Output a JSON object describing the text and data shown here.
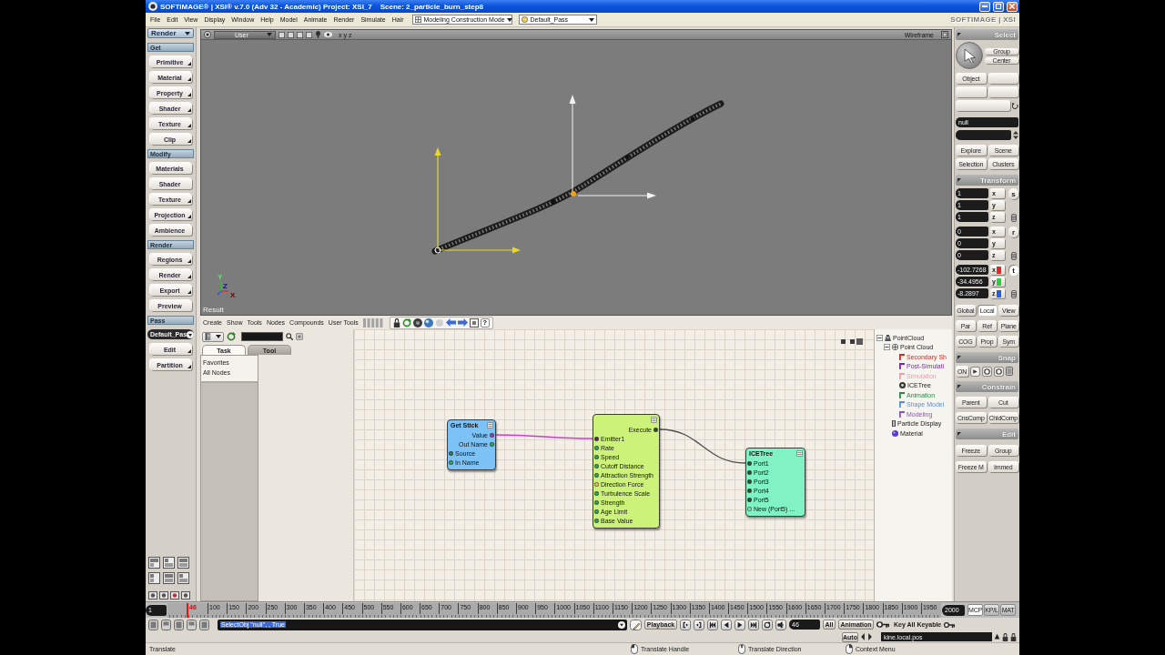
{
  "window": {
    "title": "SOFTIMAGE® | XSI® v.7.0 (Adv 32 - Academic) Project: XSI_7    Scene: 2_particle_burn_step8"
  },
  "menu_bar": {
    "items": [
      "File",
      "Edit",
      "View",
      "Display",
      "Window",
      "Help",
      "Model",
      "Animate",
      "Render",
      "Simulate",
      "Hair"
    ],
    "mode": "Modeling Construction Mode",
    "pass": "Default_Pass",
    "logo": "SOFTIMAGE | XSI"
  },
  "left_toolbar": {
    "module": "Render",
    "sections": [
      {
        "title": "Get",
        "buttons": [
          {
            "label": "Primitive",
            "submenu": true
          },
          {
            "label": "Material",
            "submenu": true
          },
          {
            "label": "Property",
            "submenu": true
          },
          {
            "label": "Shader",
            "submenu": true
          },
          {
            "label": "Texture",
            "submenu": true
          },
          {
            "label": "Clip",
            "submenu": true
          }
        ]
      },
      {
        "title": "Modify",
        "buttons": [
          {
            "label": "Materials",
            "submenu": false
          },
          {
            "label": "Shader",
            "submenu": false
          },
          {
            "label": "Texture",
            "submenu": true
          },
          {
            "label": "Projection",
            "submenu": true
          },
          {
            "label": "Ambience",
            "submenu": false
          }
        ]
      },
      {
        "title": "Render",
        "buttons": [
          {
            "label": "Regions",
            "submenu": true
          },
          {
            "label": "Render",
            "submenu": true
          },
          {
            "label": "Export",
            "submenu": true
          },
          {
            "label": "Preview",
            "submenu": false
          }
        ]
      },
      {
        "title": "Pass",
        "dropdown": "Default_Pas",
        "buttons": [
          {
            "label": "Edit",
            "submenu": true
          },
          {
            "label": "Partition",
            "submenu": true
          }
        ]
      }
    ]
  },
  "viewport": {
    "camera": "User",
    "axes": "x y z",
    "mode": "Wireframe",
    "axis_labels": [
      "Y",
      "Z",
      "X"
    ],
    "panel_label": "Result"
  },
  "ice_tree": {
    "menu": [
      "Create",
      "Show",
      "Tools",
      "Nodes",
      "Compounds",
      "User Tools"
    ],
    "help": "?",
    "tabs": [
      {
        "label": "Task",
        "selected": true
      },
      {
        "label": "Tool",
        "selected": false
      }
    ],
    "presets": [
      "Favorites",
      "All Nodes"
    ],
    "nodes": [
      {
        "title": "Get Stick",
        "color": "#7cc2f6",
        "ports": [
          {
            "name": "Value",
            "kind": "output",
            "color": "#9a3cb0"
          },
          {
            "name": "Out Name",
            "kind": "output",
            "color": "#34a05a"
          },
          {
            "name": "Source",
            "kind": "input",
            "color": "#2a7a4a"
          },
          {
            "name": "In Name",
            "kind": "input",
            "color": "#34a05a"
          }
        ]
      },
      {
        "color": "#ccf27a",
        "ports": [
          {
            "name": "Execute",
            "kind": "output",
            "color": "#3a4a3a"
          },
          {
            "name": "Emitter1",
            "kind": "input",
            "color": "#5a2a6a"
          },
          {
            "name": "Rate",
            "kind": "input",
            "color": "#34a05a"
          },
          {
            "name": "Speed",
            "kind": "input",
            "color": "#34a05a"
          },
          {
            "name": "Cutoff Distance",
            "kind": "input",
            "color": "#34a05a"
          },
          {
            "name": "Attraction Strength",
            "kind": "input",
            "color": "#34a05a"
          },
          {
            "name": "Direction Force",
            "kind": "input",
            "color": "#e0c050"
          },
          {
            "name": "Turbulence Scale",
            "kind": "input",
            "color": "#34a05a"
          },
          {
            "name": "Strength",
            "kind": "input",
            "color": "#34a05a"
          },
          {
            "name": "Age Limit",
            "kind": "input",
            "color": "#34a05a"
          },
          {
            "name": "Base Value",
            "kind": "input",
            "color": "#34a05a"
          }
        ]
      },
      {
        "title": "ICETree",
        "color": "#80f2c4",
        "ports": [
          {
            "name": "Port1",
            "kind": "input",
            "color": "#3a4a3a"
          },
          {
            "name": "Port2",
            "kind": "input",
            "color": "#3a4a3a"
          },
          {
            "name": "Port3",
            "kind": "input",
            "color": "#3a4a3a"
          },
          {
            "name": "Port4",
            "kind": "input",
            "color": "#3a4a3a"
          },
          {
            "name": "Port5",
            "kind": "input",
            "color": "#3a4a3a"
          },
          {
            "name": "New (Port5) ...",
            "kind": "input",
            "color": "#9ad8b0"
          }
        ]
      }
    ],
    "explorer": [
      {
        "label": "PointCloud",
        "kind": "model",
        "expanded": true,
        "children": [
          {
            "label": "Point Cloud",
            "kind": "geometry",
            "expanded": true,
            "children": [
              {
                "label": "Secondary Sh",
                "kind": "operator",
                "color": "#c8302c"
              },
              {
                "label": "Post-Simulati",
                "kind": "operator",
                "color": "#7a2aa8"
              },
              {
                "label": "Simulation",
                "kind": "operator",
                "color": "#e8a4ac"
              },
              {
                "label": "ICETree",
                "kind": "icetree"
              },
              {
                "label": "Animation",
                "kind": "operator",
                "color": "#2a8a48"
              },
              {
                "label": "Shape Model",
                "kind": "operator",
                "color": "#5a90d8"
              },
              {
                "label": "Modeling",
                "kind": "operator",
                "color": "#8a5aa8"
              }
            ]
          },
          {
            "label": "Particle Display",
            "kind": "property"
          },
          {
            "label": "Material",
            "kind": "material"
          }
        ]
      }
    ]
  },
  "right_panel": {
    "select": {
      "title": "Select",
      "buttons": [
        "Group",
        "Center"
      ],
      "filter": "Object",
      "name": "null",
      "nav": [
        "Explore",
        "Scene",
        "Selection",
        "Clusters"
      ]
    },
    "transform": {
      "title": "Transform",
      "groups": [
        {
          "label": "s",
          "selected": false,
          "values": [
            {
              "value": "1",
              "axis": "x"
            },
            {
              "value": "1",
              "axis": "y"
            },
            {
              "value": "1",
              "axis": "z"
            }
          ]
        },
        {
          "label": "r",
          "selected": false,
          "values": [
            {
              "value": "0",
              "axis": "x"
            },
            {
              "value": "0",
              "axis": "y"
            },
            {
              "value": "0",
              "axis": "z"
            }
          ]
        },
        {
          "label": "t",
          "selected": true,
          "values": [
            {
              "value": "-102.7268",
              "axis": "x",
              "color": "#e02828"
            },
            {
              "value": "-34.4956",
              "axis": "y",
              "color": "#28d040"
            },
            {
              "value": "-8.2897",
              "axis": "z",
              "color": "#2860e0"
            }
          ]
        }
      ],
      "reference": [
        {
          "label": "Global",
          "selected": false
        },
        {
          "label": "Local",
          "selected": true
        },
        {
          "label": "View",
          "selected": false
        }
      ],
      "rows": [
        [
          "Par",
          "Ref",
          "Plane"
        ],
        [
          "COG",
          "Prop",
          "Sym"
        ]
      ]
    },
    "snap": {
      "title": "Snap",
      "toggle": "ON"
    },
    "constrain": {
      "title": "Constrain",
      "buttons": [
        "Parent",
        "Cut",
        "CnsComp",
        "ChldComp"
      ]
    },
    "edit": {
      "title": "Edit",
      "buttons": [
        "Freeze",
        "Group",
        "Freeze M",
        "Immed"
      ]
    }
  },
  "timeline": {
    "start": "1",
    "current": "46",
    "end": "2000",
    "labels": [
      "100",
      "150",
      "200",
      "250",
      "300",
      "350",
      "400",
      "450",
      "500",
      "550",
      "600",
      "650",
      "700",
      "750",
      "800",
      "850",
      "900",
      "950",
      "1000",
      "1050",
      "1100",
      "1150",
      "1200",
      "1250",
      "1300",
      "1350",
      "1400",
      "1450",
      "1500",
      "1550",
      "1600",
      "1650",
      "1700",
      "1750",
      "1800",
      "1850",
      "1900",
      "1950"
    ],
    "tabs": [
      {
        "label": "MCP",
        "selected": true
      },
      {
        "label": "KP/L",
        "selected": false
      },
      {
        "label": "MAT",
        "selected": false
      }
    ]
  },
  "command_bar": {
    "script": "SelectObj \"null\", , True",
    "script_highlighted": true,
    "playback": "Playback",
    "frame": "46",
    "range": "All",
    "key_mode": "Animation",
    "auto": "Auto",
    "keying": "Key All Keyable",
    "parameter": "kine.local.pos"
  },
  "status_bar": {
    "message": "Translate",
    "hints": [
      {
        "kind": "left",
        "label": "Translate Handle"
      },
      {
        "kind": "middle",
        "label": "Translate Direction"
      },
      {
        "kind": "right",
        "label": "Context Menu"
      }
    ]
  }
}
